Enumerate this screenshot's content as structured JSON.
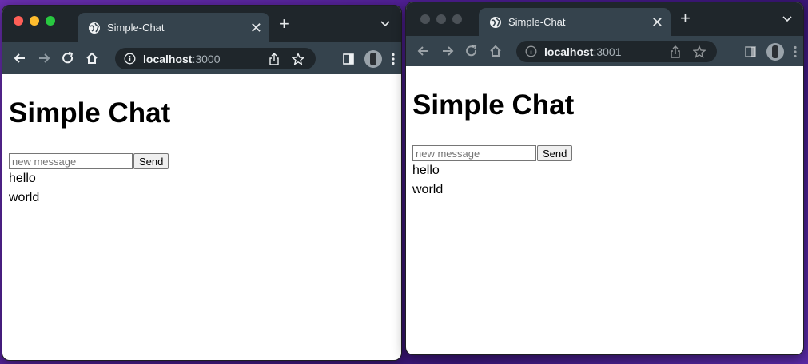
{
  "windows": [
    {
      "tab_title": "Simple-Chat",
      "url_host": "localhost",
      "url_port": ":3000",
      "heading": "Simple Chat",
      "input_placeholder": "new message",
      "send_label": "Send",
      "messages": [
        "hello",
        "world"
      ]
    },
    {
      "tab_title": "Simple-Chat",
      "url_host": "localhost",
      "url_port": ":3001",
      "heading": "Simple Chat",
      "input_placeholder": "new message",
      "send_label": "Send",
      "messages": [
        "hello",
        "world"
      ]
    }
  ],
  "icons": {
    "globe": "globe-icon",
    "close": "close-icon",
    "new_tab": "plus-icon",
    "back": "arrow-left-icon",
    "forward": "arrow-right-icon",
    "reload": "reload-icon",
    "home": "home-icon",
    "info": "info-icon",
    "share": "share-icon",
    "bookmark": "star-icon",
    "side_panel": "side-panel-icon",
    "menu": "kebab-menu-icon"
  },
  "colors": {
    "tab_strip": "#1f262b",
    "toolbar": "#35434d",
    "desktop": "#4a1c8f"
  }
}
